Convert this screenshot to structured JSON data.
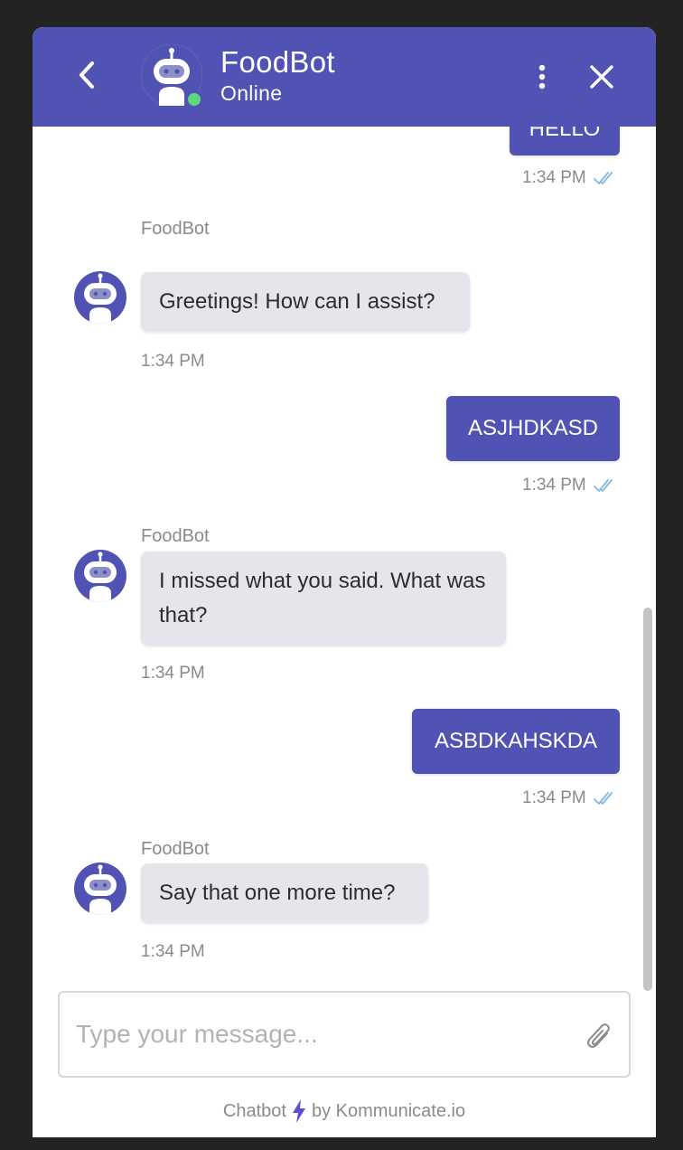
{
  "header": {
    "title": "FoodBot",
    "status": "Online",
    "status_color": "#5ed87c",
    "brand_color": "#5053b3"
  },
  "messages": [
    {
      "from": "user",
      "text": "HELLO",
      "time": "1:34 PM",
      "read": true
    },
    {
      "from": "bot",
      "sender": "FoodBot",
      "text": "Greetings! How can I assist?",
      "time": "1:34 PM"
    },
    {
      "from": "user",
      "text": "ASJHDKASD",
      "time": "1:34 PM",
      "read": true
    },
    {
      "from": "bot",
      "sender": "FoodBot",
      "text": "I missed what you said. What was that?",
      "time": "1:34 PM"
    },
    {
      "from": "user",
      "text": "ASBDKAHSKDA",
      "time": "1:34 PM",
      "read": true
    },
    {
      "from": "bot",
      "sender": "FoodBot",
      "text": "Say that one more time?",
      "time": "1:34 PM"
    }
  ],
  "composer": {
    "placeholder": "Type your message...",
    "value": ""
  },
  "footer": {
    "prefix": "Chatbot",
    "suffix": "by Kommunicate.io"
  },
  "icons": {
    "back": "chevron-left-icon",
    "menu": "kebab-menu-icon",
    "close": "close-icon",
    "attach": "paperclip-icon",
    "read_receipt": "double-check-icon",
    "bolt": "lightning-bolt-icon"
  }
}
